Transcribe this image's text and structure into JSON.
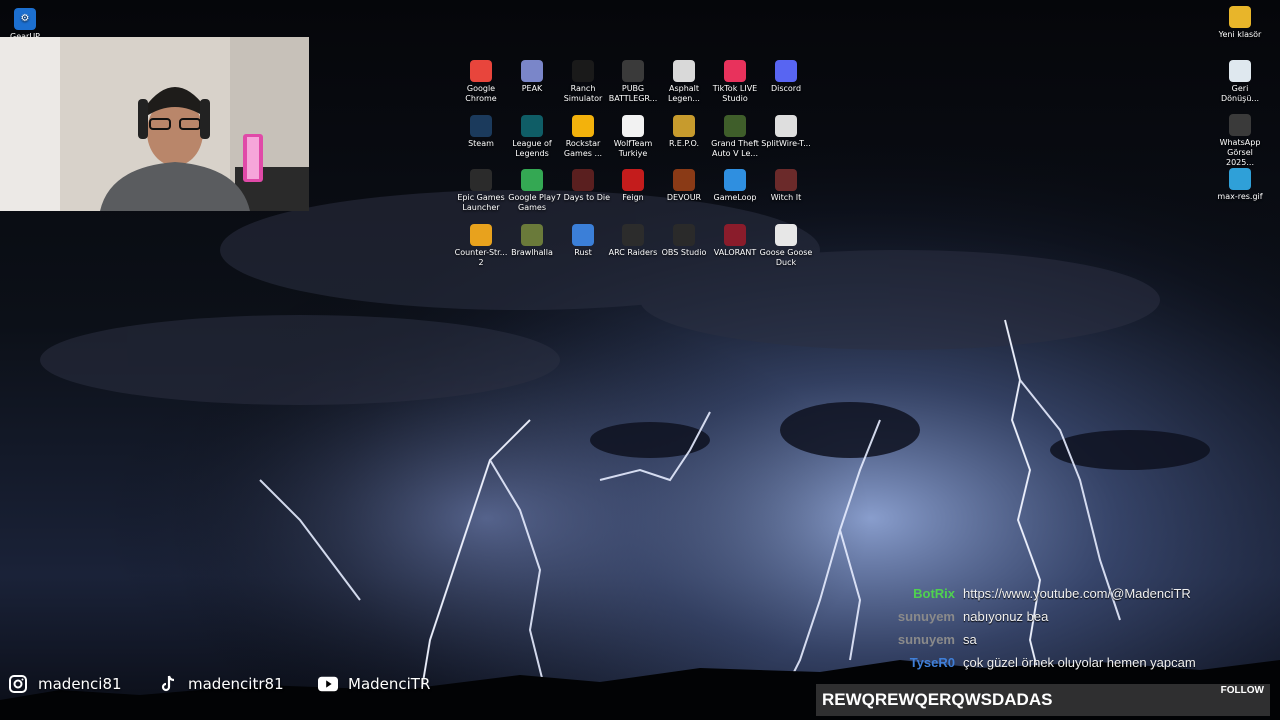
{
  "desktop": {
    "top_left_icon": {
      "label": "GearUP",
      "icon": "gearup-icon"
    },
    "right_icons": [
      {
        "label": "Yeni klasör",
        "icon": "folder-icon"
      },
      {
        "label": "Geri Dönüşü...",
        "icon": "recycle-bin-icon"
      },
      {
        "label": "WhatsApp Görsel 2025...",
        "icon": "image-file-icon"
      },
      {
        "label": "max-res.gif",
        "icon": "edge-gif-icon"
      }
    ],
    "grid_icons": [
      {
        "label": "Google Chrome",
        "icon": "chrome-icon",
        "color": "#e8453c"
      },
      {
        "label": "PEAK",
        "icon": "peak-icon",
        "color": "#7a86c9"
      },
      {
        "label": "Ranch Simulator",
        "icon": "ranch-simulator-icon",
        "color": "#1a1a1a"
      },
      {
        "label": "PUBG BATTLEGR...",
        "icon": "pubg-icon",
        "color": "#3a3a3a"
      },
      {
        "label": "Asphalt Legen...",
        "icon": "asphalt-icon",
        "color": "#d9d9d9"
      },
      {
        "label": "TikTok LIVE Studio",
        "icon": "tiktok-live-icon",
        "color": "#e8325c"
      },
      {
        "label": "Discord",
        "icon": "discord-icon",
        "color": "#5865f2"
      },
      {
        "label": "Steam",
        "icon": "steam-icon",
        "color": "#1b3a5c"
      },
      {
        "label": "League of Legends",
        "icon": "league-of-legends-icon",
        "color": "#0f5d66"
      },
      {
        "label": "Rockstar Games ...",
        "icon": "rockstar-icon",
        "color": "#f3b20c"
      },
      {
        "label": "WolfTeam Turkiye",
        "icon": "file-icon",
        "color": "#f2f2f2"
      },
      {
        "label": "R.E.P.O.",
        "icon": "repo-icon",
        "color": "#c79b2d"
      },
      {
        "label": "Grand Theft Auto V Le...",
        "icon": "gta-icon",
        "color": "#3f5e2a"
      },
      {
        "label": "SplitWire-T...",
        "icon": "splitwire-icon",
        "color": "#dedede"
      },
      {
        "label": "Epic Games Launcher",
        "icon": "epic-games-icon",
        "color": "#2b2b2b"
      },
      {
        "label": "Google Play Games",
        "icon": "google-play-games-icon",
        "color": "#34a853"
      },
      {
        "label": "7 Days to Die",
        "icon": "7-days-to-die-icon",
        "color": "#5a1f1f"
      },
      {
        "label": "Feign",
        "icon": "feign-icon",
        "color": "#c41c1c"
      },
      {
        "label": "DEVOUR",
        "icon": "devour-icon",
        "color": "#8a3a16"
      },
      {
        "label": "GameLoop",
        "icon": "gameloop-icon",
        "color": "#2f8fe0"
      },
      {
        "label": "Witch It",
        "icon": "witch-it-icon",
        "color": "#6b2a2a"
      },
      {
        "label": "Counter-Str... 2",
        "icon": "counter-strike-icon",
        "color": "#e8a21d"
      },
      {
        "label": "Brawlhalla",
        "icon": "brawlhalla-icon",
        "color": "#6a7a3a"
      },
      {
        "label": "Rust",
        "icon": "rust-icon",
        "color": "#3b7fd8"
      },
      {
        "label": "ARC Raiders",
        "icon": "arc-raiders-icon",
        "color": "#2c2c2c"
      },
      {
        "label": "OBS Studio",
        "icon": "obs-icon",
        "color": "#2a2a2a"
      },
      {
        "label": "VALORANT",
        "icon": "valorant-icon",
        "color": "#8a1c2b"
      },
      {
        "label": "Goose Goose Duck",
        "icon": "goose-goose-duck-icon",
        "color": "#e7e7e7"
      }
    ]
  },
  "socials": [
    {
      "handle": "madenci81",
      "icon": "instagram-icon"
    },
    {
      "handle": "madencitr81",
      "icon": "tiktok-icon"
    },
    {
      "handle": "MadenciTR",
      "icon": "youtube-icon"
    }
  ],
  "chat": [
    {
      "user": "BotRix",
      "text": "https://www.youtube.com/@MadenciTR",
      "color": "#4fd14f"
    },
    {
      "user": "sunuyem",
      "text": "nabıyonuz bea",
      "color": "#8a8a8a"
    },
    {
      "user": "sunuyem",
      "text": "sa",
      "color": "#8a8a8a"
    },
    {
      "user": "TyseR0",
      "text": "çok güzel örnek oluyolar hemen yapcam",
      "color": "#3f7fd8"
    }
  ],
  "follow_alert": {
    "name": "REWQREWQERQWSDADAS",
    "label": "FOLLOW"
  }
}
